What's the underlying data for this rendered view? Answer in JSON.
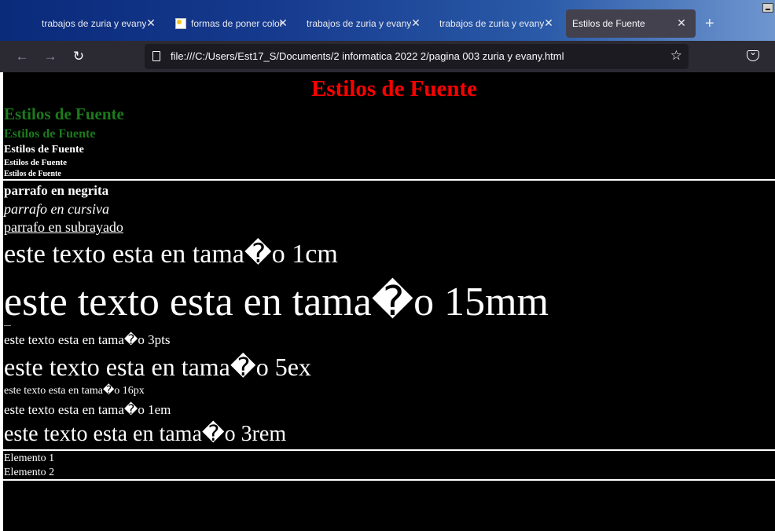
{
  "tabs": [
    {
      "label": "trabajos de zuria y evany"
    },
    {
      "label": "formas de poner color"
    },
    {
      "label": "trabajos de zuria y evany"
    },
    {
      "label": "trabajos de zuria y evany"
    },
    {
      "label": "Estilos de Fuente"
    }
  ],
  "address": {
    "url": "file:///C:/Users/Est17_S/Documents/2 informatica 2022 2/pagina 003 zuria y evany.html"
  },
  "page": {
    "title": "Estilos de Fuente",
    "headings": [
      "Estilos de Fuente",
      "Estilos de Fuente",
      "Estilos de Fuente",
      "Estilos de Fuente",
      "Estilos de Fuente"
    ],
    "p_bold": "parrafo en negrita",
    "p_italic": "parrafo en cursiva",
    "p_underline": "parrafo en subrayado",
    "sizes": [
      "este texto esta en tama�o 1cm",
      "este texto esta en tama�o 15mm",
      "este texto esta en tama�o 3pts",
      "este texto esta en tama�o 5ex",
      "este texto esta en tama�o 16px",
      "este texto esta en tama�o 1em",
      "este texto esta en tama�o 3rem"
    ],
    "list": [
      "Elemento 1",
      "Elemento 2"
    ],
    "colors": {
      "title": "#ff0000",
      "heading_green": "#1c7a1c"
    }
  }
}
